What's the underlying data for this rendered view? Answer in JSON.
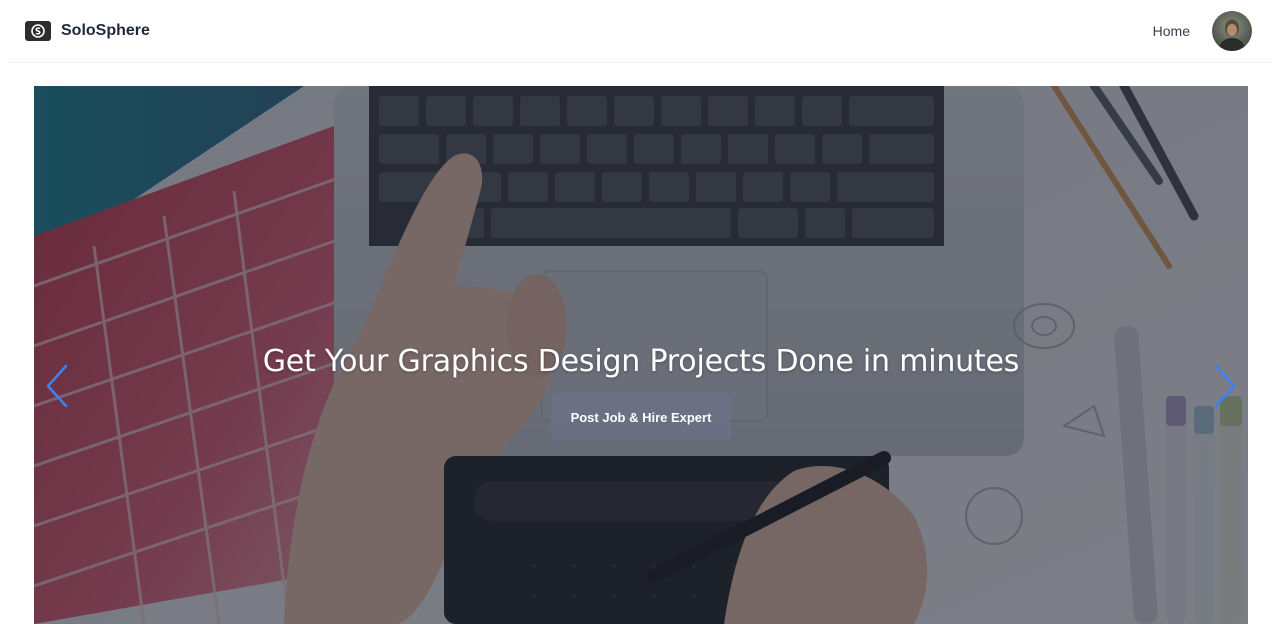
{
  "navbar": {
    "brand_name": "SoloSphere",
    "logo_icon": "solosphere-logo-icon",
    "links": [
      {
        "label": "Home"
      }
    ],
    "avatar_icon": "user-avatar"
  },
  "hero": {
    "title": "Get Your Graphics Design Projects Done in minutes",
    "cta_label": "Post Job & Hire Expert",
    "prev_icon": "chevron-left-icon",
    "next_icon": "chevron-right-icon",
    "arrow_color": "#3b82f6"
  },
  "colors": {
    "overlay": "#191e2a",
    "brand_text": "#1f2937",
    "cta_background": "#6b748c"
  }
}
